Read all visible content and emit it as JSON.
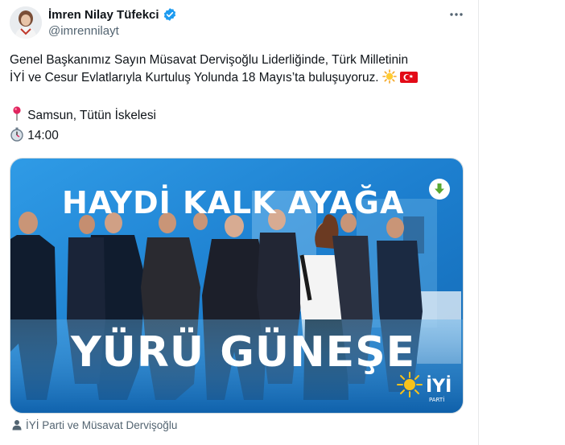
{
  "tweet": {
    "author": {
      "display_name": "İmren Nilay Tüfekci",
      "handle": "@imrennilayt",
      "verified": true
    },
    "text": {
      "line1": "Genel Başkanımız Sayın Müsavat Dervişoğlu Liderliğinde, Türk Milletinin",
      "line2": "İYİ ve Cesur Evlatlarıyla Kurtuluş Yolunda 18 Mayıs’ta buluşuyoruz.",
      "location": "Samsun, Tütün İskelesi",
      "time": "14:00"
    },
    "media": {
      "headline_top": "HAYDİ KALK AYAĞA",
      "headline_bottom": "YÜRÜ GÜNEŞE",
      "logo_text": "İYİ",
      "logo_sub": "PARTİ"
    },
    "tagged_people": "İYİ Parti ve Müsavat Dervişoğlu"
  },
  "icons": {
    "verified": "verified-badge-icon",
    "more": "more-options-icon",
    "pin": "round-pushpin-emoji",
    "timer": "stopwatch-emoji",
    "sun": "sun-emoji",
    "flag": "turkish-flag-emoji",
    "download": "download-arrow-icon",
    "person": "person-tag-icon"
  },
  "colors": {
    "text_primary": "#0f1419",
    "text_secondary": "#536471",
    "verified_blue": "#1d9bf0",
    "media_blue": "#1e88d8",
    "download_green": "#5aa832",
    "logo_yellow": "#f6c21c"
  }
}
